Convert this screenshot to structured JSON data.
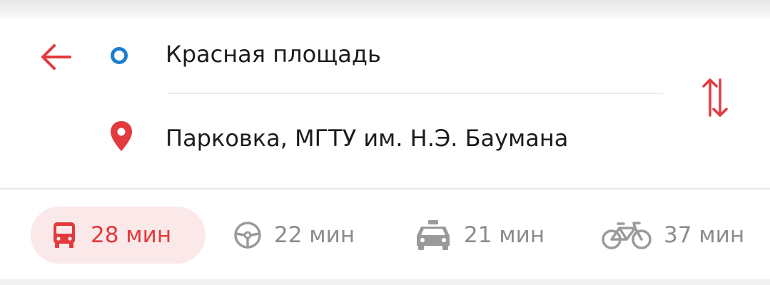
{
  "route": {
    "from": {
      "value": "Красная площадь"
    },
    "to": {
      "value": "Парковка, МГТУ им. Н.Э. Баумана"
    }
  },
  "modes": [
    {
      "id": "transit",
      "icon": "bus-icon",
      "label": "28 мин",
      "active": true
    },
    {
      "id": "car",
      "icon": "steering-wheel-icon",
      "label": "22 мин",
      "active": false
    },
    {
      "id": "taxi",
      "icon": "taxi-icon",
      "label": "21 мин",
      "active": false
    },
    {
      "id": "bike",
      "icon": "bicycle-icon",
      "label": "37 мин",
      "active": false
    }
  ],
  "colors": {
    "accent": "#e23a3d",
    "accent_bg": "#fbe8e8",
    "origin": "#1a7fd0",
    "inactive": "#8c8c8c"
  }
}
